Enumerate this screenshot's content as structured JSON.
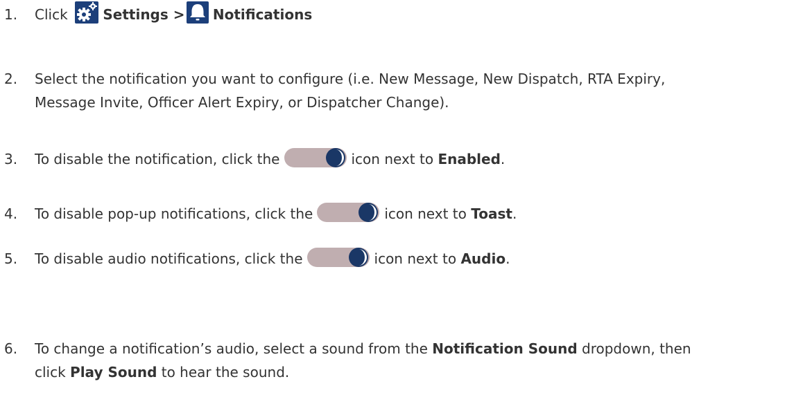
{
  "steps": {
    "s1": {
      "num": "1.",
      "click": "Click",
      "settings": "Settings >",
      "notifications": "Notifications"
    },
    "s2": {
      "num": "2.",
      "line1": "Select the notification you want to configure (i.e. New Message, New Dispatch, RTA Expiry,",
      "line2": "Message Invite, Officer Alert Expiry, or Dispatcher Change)."
    },
    "s3": {
      "num": "3.",
      "pre": "To disable the notification, click the",
      "post": "icon next to",
      "bold": "Enabled",
      "end": "."
    },
    "s4": {
      "num": "4.",
      "pre": "To disable pop-up notifications, click the",
      "post": "icon next to",
      "bold": "Toast",
      "end": "."
    },
    "s5": {
      "num": "5.",
      "pre": "To disable audio notifications, click the",
      "post": "icon next to",
      "bold": "Audio",
      "end": "."
    },
    "s6": {
      "num": "6.",
      "pre": "To change a notification’s audio, select a sound from the",
      "bold1": "Notification Sound",
      "mid": "dropdown, then",
      "line2_pre": "click",
      "bold2": "Play Sound",
      "line2_post": "to hear the sound."
    }
  },
  "icons": {
    "settings": "gears-icon",
    "notifications": "bell-icon",
    "toggle": "toggle-switch-icon"
  },
  "colors": {
    "icon_blue": "#1c3f7a",
    "toggle_track": "#c0aeb0",
    "toggle_knob": "#1a3766",
    "text": "#333333"
  }
}
